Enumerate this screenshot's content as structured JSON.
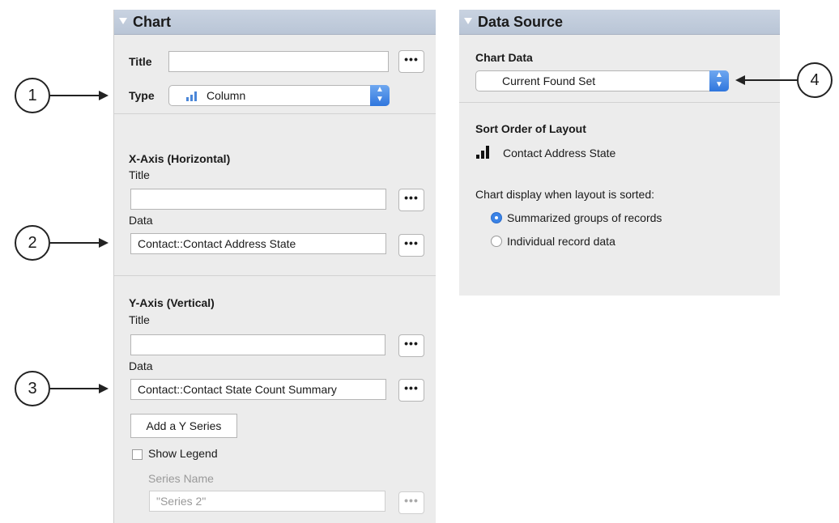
{
  "chart_panel": {
    "header": "Chart",
    "title_label": "Title",
    "title_value": "",
    "type_label": "Type",
    "type_value": "Column",
    "x_axis": {
      "heading": "X-Axis (Horizontal)",
      "title_label": "Title",
      "title_value": "",
      "data_label": "Data",
      "data_value": "Contact::Contact Address State"
    },
    "y_axis": {
      "heading": "Y-Axis (Vertical)",
      "title_label": "Title",
      "title_value": "",
      "data_label": "Data",
      "data_value": "Contact::Contact State Count Summary"
    },
    "add_series_label": "Add a Y Series",
    "show_legend_label": "Show Legend",
    "series_name_label": "Series Name",
    "series_name_value": "\"Series 2\"",
    "dots": "•••"
  },
  "data_source_panel": {
    "header": "Data Source",
    "chart_data_label": "Chart Data",
    "chart_data_value": "Current Found Set",
    "sort_order_label": "Sort Order of Layout",
    "sort_field": "Contact Address State",
    "display_label": "Chart display when layout is sorted:",
    "options": [
      {
        "label": "Summarized groups of records",
        "selected": true
      },
      {
        "label": "Individual record data",
        "selected": false
      }
    ]
  },
  "callouts": [
    "1",
    "2",
    "3",
    "4"
  ],
  "colors": {
    "header_bg": "#c9d3e1",
    "panel_bg": "#ececec",
    "accent_blue": "#3b83e6"
  },
  "icons": {
    "type_icon": "column-chart-icon",
    "sort_icon": "bar-chart-icon",
    "stepper": "up-down-stepper-icon"
  }
}
